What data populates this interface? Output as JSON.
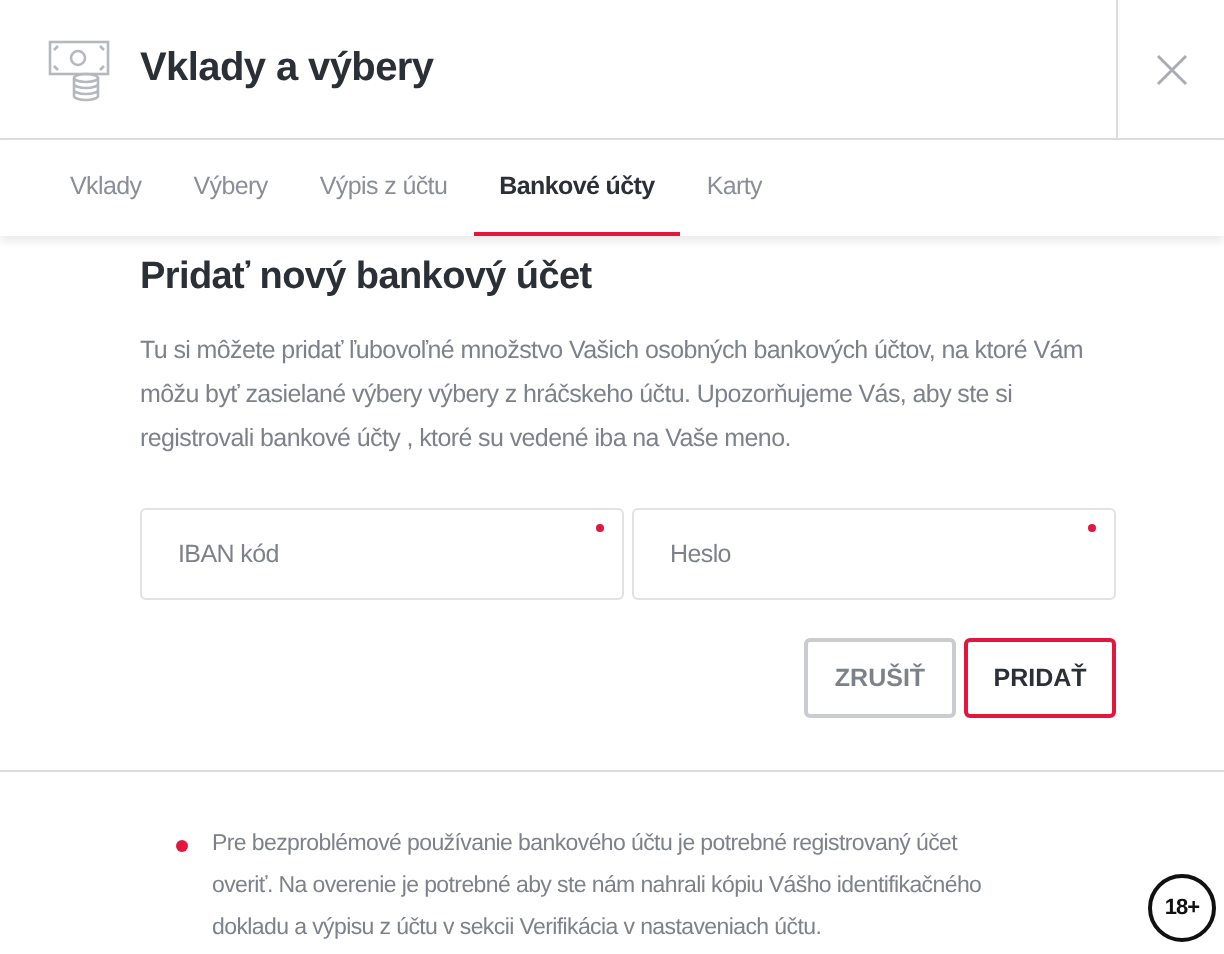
{
  "window": {
    "title": "Vklady a výbery"
  },
  "tabs": [
    {
      "label": "Vklady",
      "selected": false
    },
    {
      "label": "Výbery",
      "selected": false
    },
    {
      "label": "Výpis z účtu",
      "selected": false
    },
    {
      "label": "Bankové účty",
      "selected": true
    },
    {
      "label": "Karty",
      "selected": false
    }
  ],
  "form": {
    "heading": "Pridať nový bankový účet",
    "description": "Tu si môžete pridať ľubovoľné množstvo Vašich osobných bankových účtov, na ktoré Vám môžu byť zasielané výbery výbery z hráčskeho účtu. Upozorňujeme Vás, aby ste si registrovali bankové účty , ktoré su vedené iba na Vaše meno.",
    "fields": [
      {
        "placeholder": "IBAN kód",
        "required": true
      },
      {
        "placeholder": "Heslo",
        "required": true
      }
    ],
    "buttons": [
      {
        "label": "ZRUŠIŤ",
        "kind": "secondary"
      },
      {
        "label": "PRIDAŤ",
        "kind": "primary"
      }
    ]
  },
  "notice": {
    "text": "Pre bezproblémové používanie bankového účtu je potrebné registrovaný účet overiť. Na overenie je potrebné aby ste nám nahrali kópiu Vášho identifikačného dokladu a výpisu z účtu v sekcii Verifikácia v nastaveniach účtu."
  },
  "age_badge": "18+"
}
